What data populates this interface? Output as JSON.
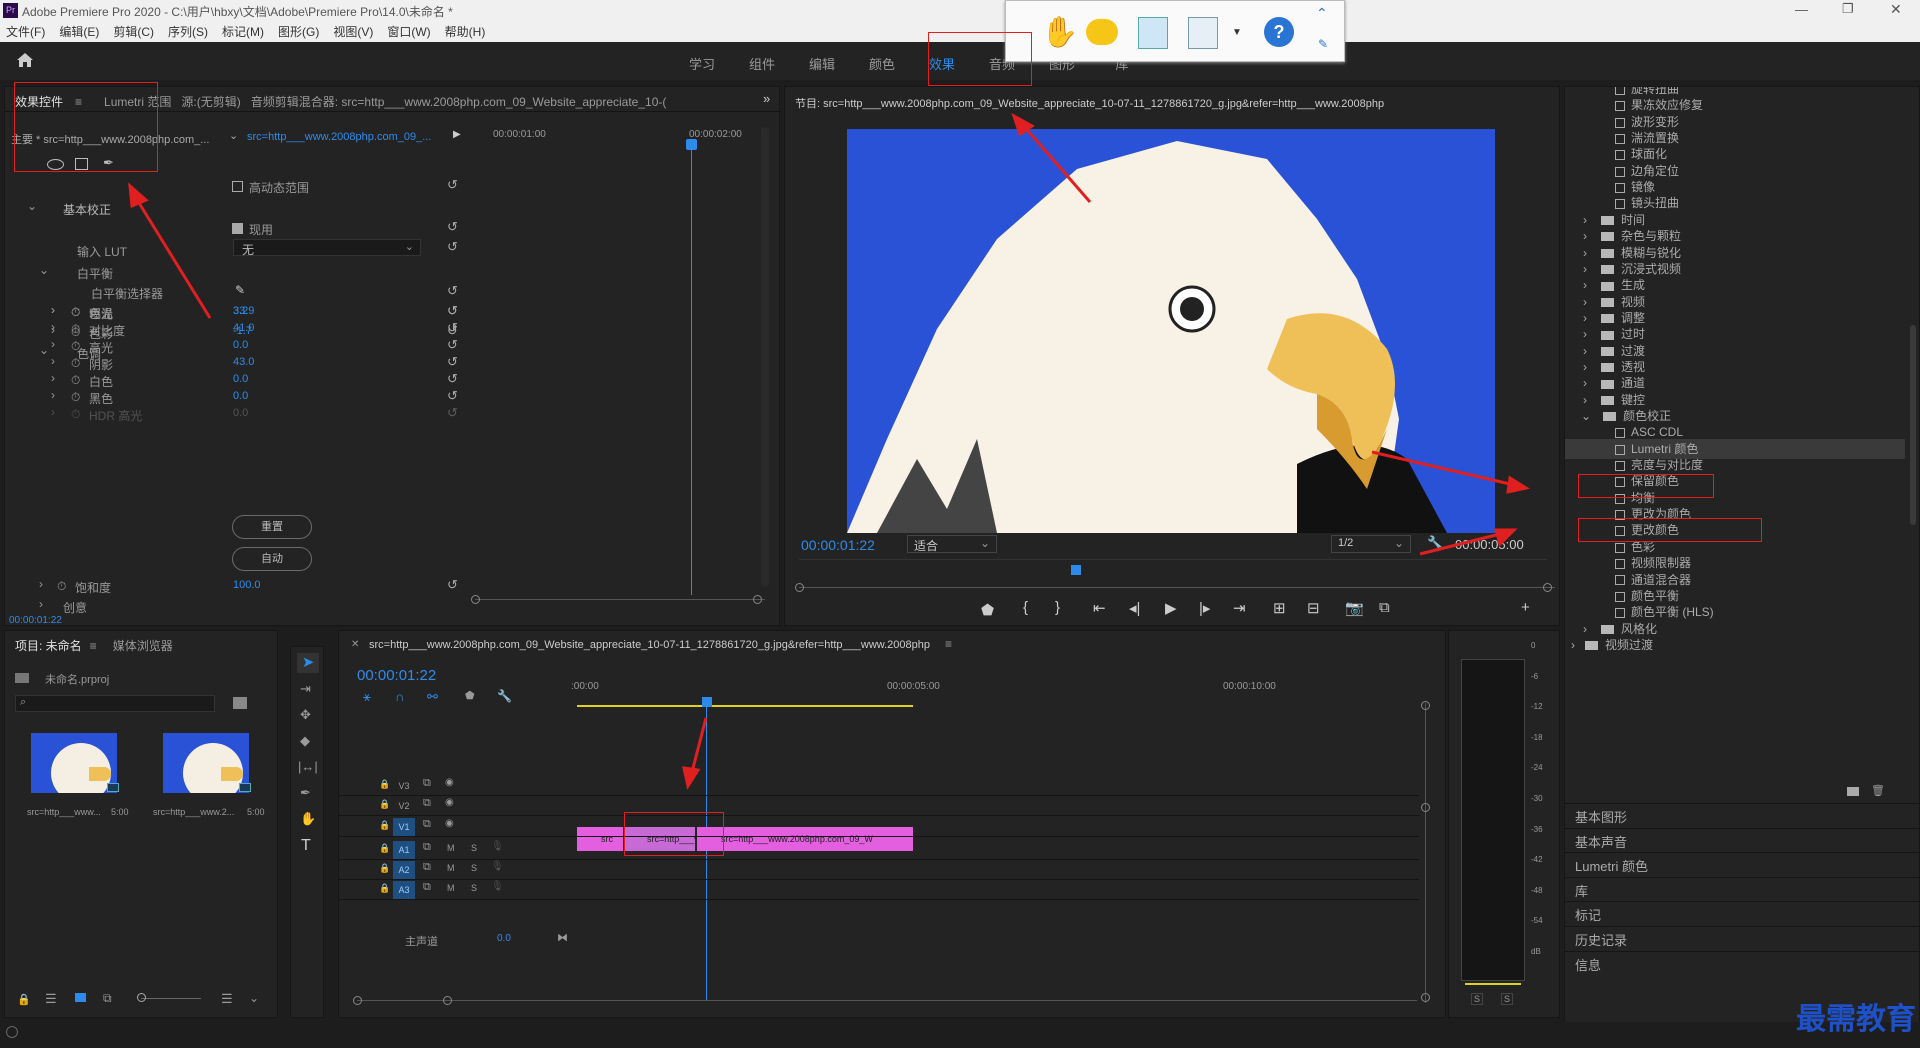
{
  "app": {
    "title": "Adobe Premiere Pro 2020 - C:\\用户\\hbxy\\文档\\Adobe\\Premiere Pro\\14.0\\未命名 *",
    "icon_label": "Pr"
  },
  "menu": [
    "文件(F)",
    "编辑(E)",
    "剪辑(C)",
    "序列(S)",
    "标记(M)",
    "图形(G)",
    "视图(V)",
    "窗口(W)",
    "帮助(H)"
  ],
  "workspaces": [
    "学习",
    "组件",
    "编辑",
    "颜色",
    "效果",
    "音频",
    "图形",
    "库"
  ],
  "effect_controls": {
    "tabs": [
      "效果控件",
      "Lumetri 范围",
      "源:(无剪辑)",
      "音频剪辑混合器: src=http___www.2008php.com_09_Website_appreciate_10-("
    ],
    "master": "主要 * src=http___www.2008php.com_...",
    "clip": "src=http___www.2008php.com_09_...",
    "time1": "00:00:01:00",
    "time2": "00:00:02:00",
    "hdr_label": "高动态范围",
    "basic": "基本校正",
    "use": "现用",
    "lut_label": "输入 LUT",
    "lut_value": "无",
    "wb": "白平衡",
    "wb_picker": "白平衡选择器",
    "temp": {
      "label": "色温",
      "value": "33.9"
    },
    "tint": {
      "label": "色彩",
      "value": "-1.7"
    },
    "tone": "色调",
    "params": [
      {
        "label": "曝光",
        "value": "3.2"
      },
      {
        "label": "对比度",
        "value": "41.0"
      },
      {
        "label": "高光",
        "value": "0.0"
      },
      {
        "label": "阴影",
        "value": "43.0"
      },
      {
        "label": "白色",
        "value": "0.0"
      },
      {
        "label": "黑色",
        "value": "0.0"
      },
      {
        "label": "HDR 高光",
        "value": "0.0"
      }
    ],
    "reset_btn": "重置",
    "auto_btn": "自动",
    "sat": {
      "label": "饱和度",
      "value": "100.0"
    },
    "creative": "创意",
    "timecode": "00:00:01:22"
  },
  "program": {
    "title": "节目: src=http___www.2008php.com_09_Website_appreciate_10-07-11_1278861720_g.jpg&refer=http___www.2008php",
    "timecode": "00:00:01:22",
    "fit": "适合",
    "res": "1/2",
    "duration": "00:00:05:00"
  },
  "project": {
    "tabs": [
      "项目: 未命名",
      "媒体浏览器"
    ],
    "file": "未命名.prproj",
    "items": [
      {
        "name": "src=http___www...",
        "dur": "5:00"
      },
      {
        "name": "src=http___www.2...",
        "dur": "5:00"
      }
    ]
  },
  "timeline": {
    "title": "src=http___www.2008php.com_09_Website_appreciate_10-07-11_1278861720_g.jpg&refer=http___www.2008php",
    "timecode": "00:00:01:22",
    "ruler": [
      ":00:00",
      "00:00:05:00",
      "00:00:10:00"
    ],
    "tracks_v": [
      "V3",
      "V2",
      "V1"
    ],
    "tracks_a": [
      "A1",
      "A2",
      "A3"
    ],
    "master": "主声道",
    "master_val": "0.0",
    "clips": [
      "src",
      "src=http___ww",
      "src=http___www.2008php.com_09_W"
    ]
  },
  "meter": {
    "scale": [
      "0",
      "-6",
      "-12",
      "-18",
      "-24",
      "-30",
      "-36",
      "-42",
      "-48",
      "-54",
      "dB"
    ],
    "solo": [
      "S",
      "S"
    ]
  },
  "effects_tree": {
    "items": [
      {
        "type": "fx",
        "label": "旋转扭曲"
      },
      {
        "type": "fx",
        "label": "果冻效应修复"
      },
      {
        "type": "fx",
        "label": "波形变形"
      },
      {
        "type": "fx",
        "label": "湍流置换"
      },
      {
        "type": "fx",
        "label": "球面化"
      },
      {
        "type": "fx",
        "label": "边角定位"
      },
      {
        "type": "fx",
        "label": "镜像"
      },
      {
        "type": "fx",
        "label": "镜头扭曲"
      },
      {
        "type": "folder",
        "label": "时间"
      },
      {
        "type": "folder",
        "label": "杂色与颗粒"
      },
      {
        "type": "folder",
        "label": "模糊与锐化"
      },
      {
        "type": "folder",
        "label": "沉浸式视频"
      },
      {
        "type": "folder",
        "label": "生成"
      },
      {
        "type": "folder",
        "label": "视频"
      },
      {
        "type": "folder",
        "label": "调整"
      },
      {
        "type": "folder",
        "label": "过时"
      },
      {
        "type": "folder",
        "label": "过渡"
      },
      {
        "type": "folder",
        "label": "透视"
      },
      {
        "type": "folder",
        "label": "通道"
      },
      {
        "type": "folder",
        "label": "键控"
      },
      {
        "type": "open",
        "label": "颜色校正"
      },
      {
        "type": "fx",
        "label": "ASC CDL"
      },
      {
        "type": "fx",
        "label": "Lumetri 颜色"
      },
      {
        "type": "fx",
        "label": "亮度与对比度"
      },
      {
        "type": "fx",
        "label": "保留颜色"
      },
      {
        "type": "fx",
        "label": "均衡"
      },
      {
        "type": "fx",
        "label": "更改为颜色"
      },
      {
        "type": "fx",
        "label": "更改颜色"
      },
      {
        "type": "fx",
        "label": "色彩"
      },
      {
        "type": "fx",
        "label": "视频限制器"
      },
      {
        "type": "fx",
        "label": "通道混合器"
      },
      {
        "type": "fx",
        "label": "颜色平衡"
      },
      {
        "type": "fx",
        "label": "颜色平衡 (HLS)"
      },
      {
        "type": "folder",
        "label": "风格化"
      },
      {
        "type": "topfolder",
        "label": "视频过渡"
      }
    ],
    "sections": [
      "基本图形",
      "基本声音",
      "Lumetri 颜色",
      "库",
      "标记",
      "历史记录",
      "信息"
    ]
  },
  "watermark": "最需教育",
  "colors": {
    "accent": "#2d8ceb",
    "clip": "#e35fe0",
    "annot": "#e02020"
  }
}
